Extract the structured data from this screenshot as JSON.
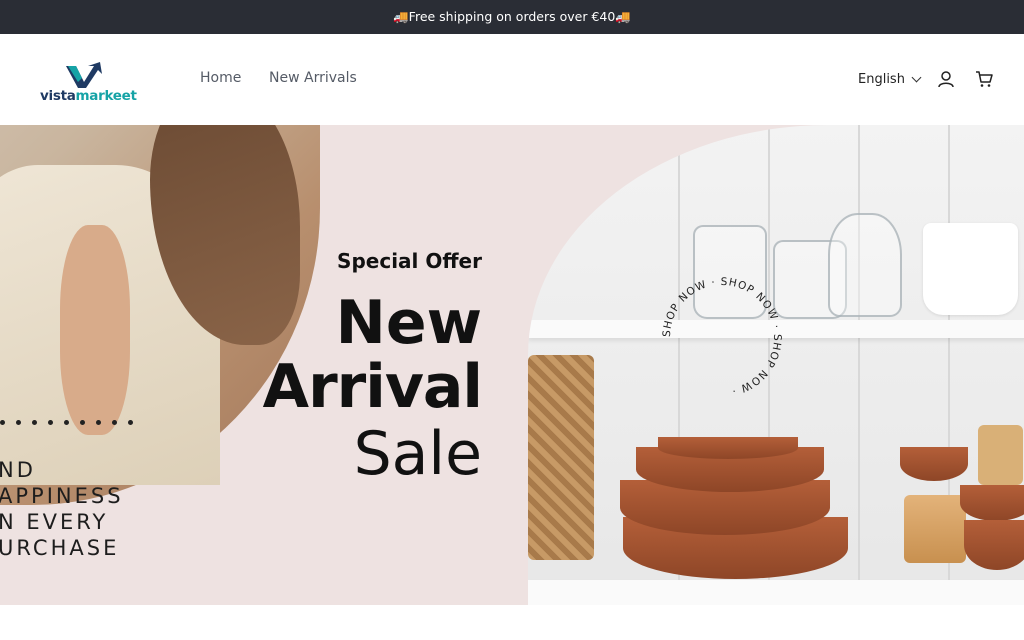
{
  "announcement": {
    "text": "🚚Free shipping on orders over €40🚚"
  },
  "header": {
    "logo": {
      "part1": "vista",
      "part2": "markeet"
    },
    "nav": [
      {
        "label": "Home"
      },
      {
        "label": "New Arrivals"
      }
    ],
    "language": {
      "label": "English"
    }
  },
  "hero": {
    "circle_text": "SHOP NOW · SHOP NOW · SHOP NOW · ",
    "special_offer": "Special Offer",
    "line1": "New",
    "line2": "Arrival",
    "line3": "Sale",
    "slogan": [
      "ND",
      "APPINESS",
      "N EVERY",
      "URCHASE"
    ]
  },
  "colors": {
    "topbar": "#2a2d35",
    "hero_bg": "#eee2e1",
    "logo_dark": "#1f3a63",
    "logo_accent": "#16a3a6"
  },
  "icons": [
    "user-icon",
    "cart-icon",
    "chevron-down-icon"
  ]
}
